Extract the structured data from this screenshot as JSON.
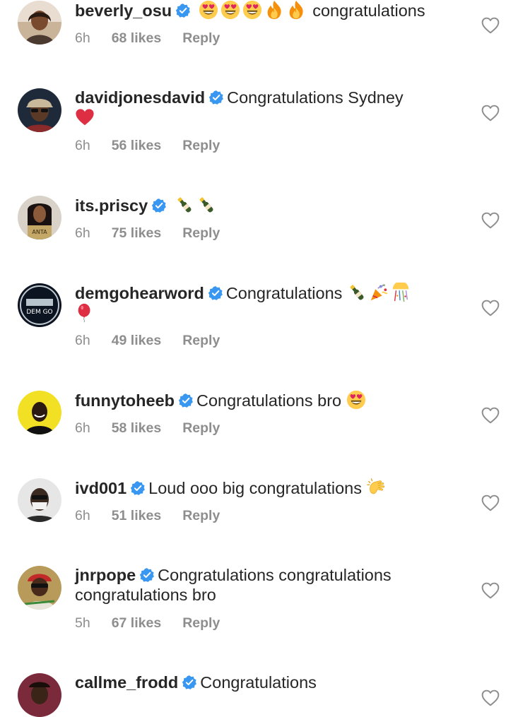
{
  "comments": [
    {
      "username": "beverly_osu",
      "text": "congratulations",
      "emojis": [
        "heart-eyes",
        "heart-eyes",
        "heart-eyes",
        "fire",
        "fire"
      ],
      "time": "6h",
      "likes": "68 likes",
      "reply": "Reply"
    },
    {
      "username": "davidjonesdavid",
      "text": "Congratulations Sydney",
      "emojis_after": [
        "red-heart"
      ],
      "time": "6h",
      "likes": "56 likes",
      "reply": "Reply"
    },
    {
      "username": "its.priscy",
      "text": "",
      "emojis": [
        "champagne",
        "champagne"
      ],
      "time": "6h",
      "likes": "75 likes",
      "reply": "Reply"
    },
    {
      "username": "demgohearword",
      "text": "Congratulations",
      "emojis": [
        "champagne",
        "party-popper",
        "confetti-ball",
        "balloon"
      ],
      "time": "6h",
      "likes": "49 likes",
      "reply": "Reply"
    },
    {
      "username": "funnytoheeb",
      "text": "Congratulations bro",
      "emojis": [
        "heart-eyes"
      ],
      "time": "6h",
      "likes": "58 likes",
      "reply": "Reply"
    },
    {
      "username": "ivd001",
      "text": "Loud ooo big congratulations",
      "emojis": [
        "clapping-hands"
      ],
      "time": "6h",
      "likes": "51 likes",
      "reply": "Reply"
    },
    {
      "username": "jnrpope",
      "text": "Congratulations congratulations congratulations bro",
      "time": "5h",
      "likes": "67 likes",
      "reply": "Reply"
    },
    {
      "username": "callme_frodd",
      "text": "Congratulations",
      "time": "",
      "likes": "",
      "reply": ""
    }
  ],
  "icons": {
    "verified": "verified-badge-icon",
    "like": "heart-outline-icon"
  },
  "colors": {
    "verified": "#3897f0",
    "meta_text": "#8e8e8e",
    "text": "#262626",
    "heart_outline": "#8e8e8e"
  }
}
